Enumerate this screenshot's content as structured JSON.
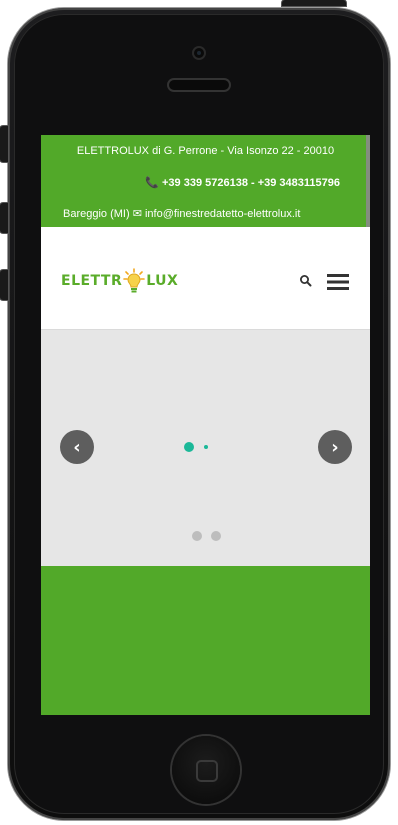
{
  "topbar": {
    "address": "ELETTROLUX di G. Perrone - Via Isonzo 22 - 20010",
    "phones": "📞 +39 339 5726138 - +39 3483115796",
    "city_email": "Bareggio (MI)  ✉ info@finestredatetto-elettrolux.it"
  },
  "header": {
    "logo_left": "ELETTR",
    "logo_right": "LUX"
  },
  "slider": {
    "prev_label": "‹",
    "next_label": "›",
    "pages": 2,
    "active_page": 1
  },
  "colors": {
    "brand_green": "#52a929",
    "accent_teal": "#1bb898"
  },
  "icons": [
    "search-icon",
    "hamburger-menu-icon",
    "phone-icon",
    "envelope-icon",
    "lightbulb-icon",
    "chevron-left-icon",
    "chevron-right-icon"
  ]
}
